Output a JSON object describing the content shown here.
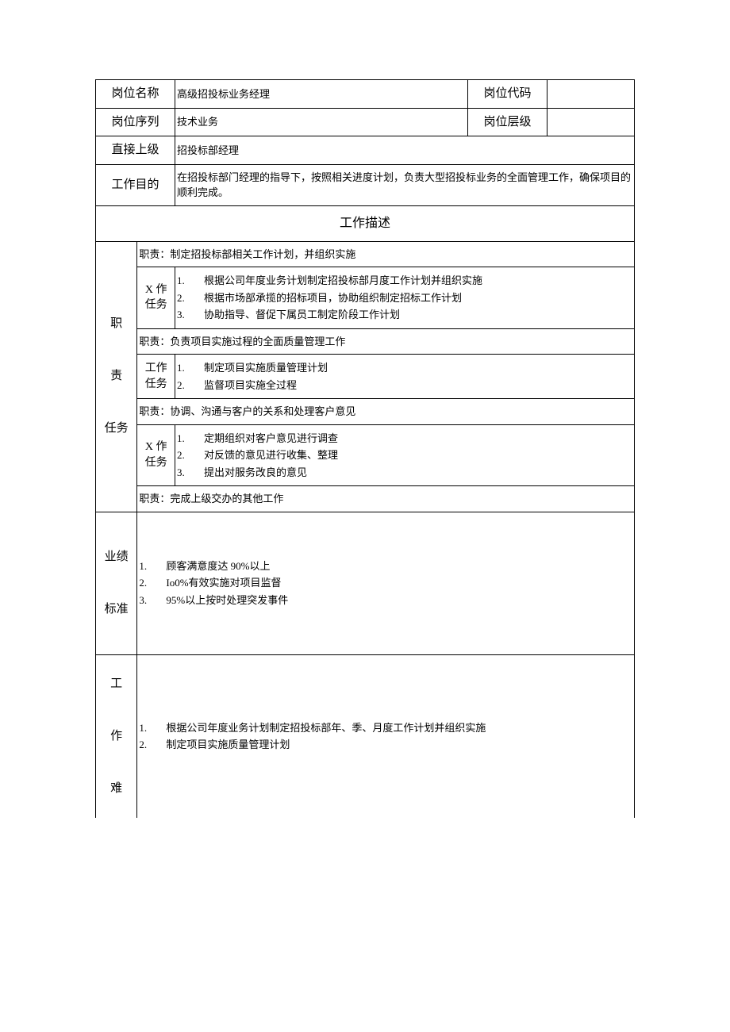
{
  "header": {
    "position_name_label": "岗位名称",
    "position_name_value": "高级招投标业务经理",
    "position_code_label": "岗位代码",
    "position_code_value": "",
    "position_series_label": "岗位序列",
    "position_series_value": "技术业务",
    "position_level_label": "岗位层级",
    "position_level_value": "",
    "direct_superior_label": "直接上级",
    "direct_superior_value": "招投标部经理",
    "work_purpose_label": "工作目的",
    "work_purpose_value": "在招投标部门经理的指导下，按照相关进度计划，负责大型招投标业务的全面管理工作，确保项目的顺利完成。"
  },
  "section_title": "工作描述",
  "duties": {
    "label": "职\n\n责\n\n任务",
    "items": [
      {
        "duty": "职责：制定招投标部相关工作计划，并组织实施",
        "task_label": "X 作任务",
        "tasks": [
          "根据公司年度业务计划制定招投标部月度工作计划并组织实施",
          "根据市场部承揽的招标项目，协助组织制定招标工作计划",
          "协助指导、督促下属员工制定阶段工作计划"
        ]
      },
      {
        "duty": "职责：负责项目实施过程的全面质量管理工作",
        "task_label": "工作任务",
        "tasks": [
          "制定项目实施质量管理计划",
          "监督项目实施全过程"
        ]
      },
      {
        "duty": "职责：协调、沟通与客户的关系和处理客户意见",
        "task_label": "X 作任务",
        "tasks": [
          "定期组织对客户意见进行调查",
          "对反馈的意见进行收集、整理",
          "提出对服务改良的意见"
        ]
      },
      {
        "duty": "职责：完成上级交办的其他工作"
      }
    ]
  },
  "performance": {
    "label": "业绩\n\n标准",
    "items": [
      "顾客满意度达 90%以上",
      "Io0%有效实施对项目监督",
      "95%以上按时处理突发事件"
    ]
  },
  "difficulty": {
    "label": "工\n\n作\n\n难",
    "items": [
      "根据公司年度业务计划制定招投标部年、季、月度工作计划并组织实施",
      "制定项目实施质量管理计划"
    ]
  }
}
